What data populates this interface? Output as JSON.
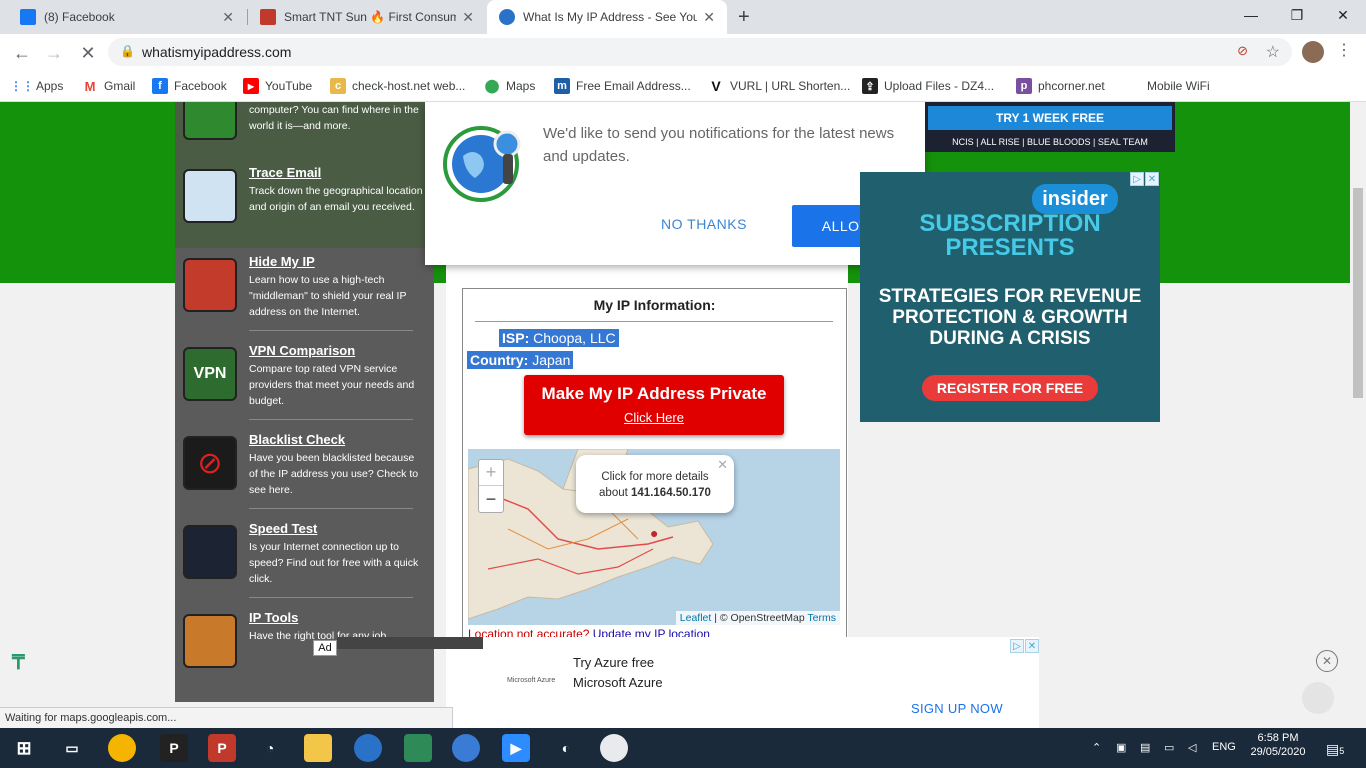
{
  "browser": {
    "tabs": [
      {
        "title": "(8) Facebook",
        "color": "#1877f2",
        "active": false
      },
      {
        "title": "Smart TNT Sun 🔥 First Consume",
        "color": "#c0392b",
        "active": false
      },
      {
        "title": "What Is My IP Address - See Your",
        "color": "#2a72c8",
        "active": true
      }
    ],
    "new_tab": "+",
    "url": "whatismyipaddress.com",
    "bookmarks": [
      {
        "label": "Apps",
        "icon": "apps-grid-icon"
      },
      {
        "label": "Gmail",
        "icon": "gmail-icon"
      },
      {
        "label": "Facebook",
        "icon": "facebook-icon"
      },
      {
        "label": "YouTube",
        "icon": "youtube-icon"
      },
      {
        "label": "check-host.net web...",
        "icon": "checkhost-icon"
      },
      {
        "label": "Maps",
        "icon": "maps-icon"
      },
      {
        "label": "Free Email Address...",
        "icon": "mail-icon"
      },
      {
        "label": "VURL | URL Shorten...",
        "icon": "vurl-icon"
      },
      {
        "label": "Upload Files - DZ4...",
        "icon": "upload-icon"
      },
      {
        "label": "phcorner.net",
        "icon": "phcorner-icon"
      },
      {
        "label": "Mobile WiFi",
        "icon": "wifi-icon"
      }
    ]
  },
  "sidebar": {
    "partial_text": "computer? You can find where in the world it is—and more.",
    "items": [
      {
        "title": "Trace Email",
        "desc": "Track down the geographical location and origin of an email you received."
      },
      {
        "title": "Hide My IP",
        "desc": "Learn how to use a high-tech \"middleman\" to shield your real IP address on the Internet."
      },
      {
        "title": "VPN Comparison",
        "desc": "Compare top rated VPN service providers that meet your needs and budget."
      },
      {
        "title": "Blacklist Check",
        "desc": "Have you been blacklisted because of the IP address you use? Check to see here."
      },
      {
        "title": "Speed Test",
        "desc": "Is your Internet connection up to speed? Find out for free with a quick click."
      },
      {
        "title": "IP Tools",
        "desc": "Have the right tool for any job."
      }
    ]
  },
  "notification": {
    "message": "We'd like to send you notifications for the latest news and updates.",
    "no_thanks": "NO THANKS",
    "allow": "ALLOW"
  },
  "ipinfo": {
    "heading": "My IP Information:",
    "isp_label": "ISP:",
    "isp_value": "Choopa, LLC",
    "country_label": "Country:",
    "country_value": "Japan",
    "private_button": "Make My IP Address Private",
    "private_link": "Click Here",
    "map_popup_line1": "Click for more details",
    "map_popup_about": "about",
    "ip": "141.164.50.170",
    "zoom_in": "+",
    "zoom_out": "−",
    "attrib_leaflet": "Leaflet",
    "attrib_osm": "| © OpenStreetMap",
    "attrib_terms": "Terms",
    "location_note": "Location not accurate?",
    "update_link": "Update my IP location"
  },
  "ads": {
    "top_try": "TRY 1 WEEK FREE",
    "top_shows": "NCIS | ALL RISE | BLUE BLOODS | SEAL TEAM",
    "insider": "insider",
    "subscription": "SUBSCRIPTION PRESENTS",
    "headline": "STRATEGIES FOR REVENUE PROTECTION & GROWTH DURING A CRISIS",
    "register": "REGISTER FOR FREE",
    "ad_label": "Ad",
    "bottom_brand": "Microsoft Azure",
    "bottom_line1": "Try Azure free",
    "bottom_line2": "Microsoft Azure",
    "bottom_cta": "SIGN UP NOW"
  },
  "status": "Waiting for maps.googleapis.com...",
  "taskbar": {
    "language": "ENG",
    "time": "6:58 PM",
    "date": "29/05/2020",
    "notifications": "5"
  }
}
